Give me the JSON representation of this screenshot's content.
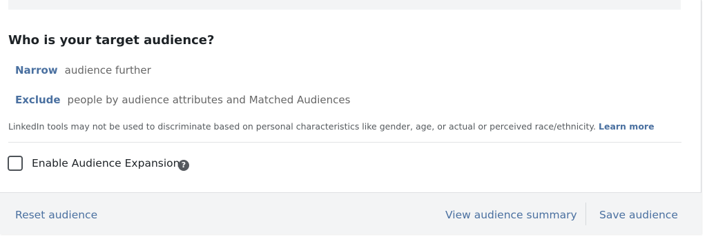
{
  "question": "Who is your target audience?",
  "narrow": {
    "link": "Narrow",
    "desc": "audience further"
  },
  "exclude": {
    "link": "Exclude",
    "desc": "people by audience attributes and Matched Audiences"
  },
  "disclaimer": {
    "text": "LinkedIn tools may not be used to discriminate based on personal characteristics like gender, age, or actual or perceived race/ethnicity.",
    "learn_more": "Learn more"
  },
  "expansion": {
    "label": "Enable Audience Expansion",
    "checked": false,
    "help_glyph": "?"
  },
  "footer": {
    "reset": "Reset audience",
    "view_summary": "View audience summary",
    "save": "Save audience"
  },
  "colors": {
    "link": "#4a70a0",
    "footer_bg": "#f3f4f5"
  },
  "icons": {
    "help": "help-icon"
  }
}
